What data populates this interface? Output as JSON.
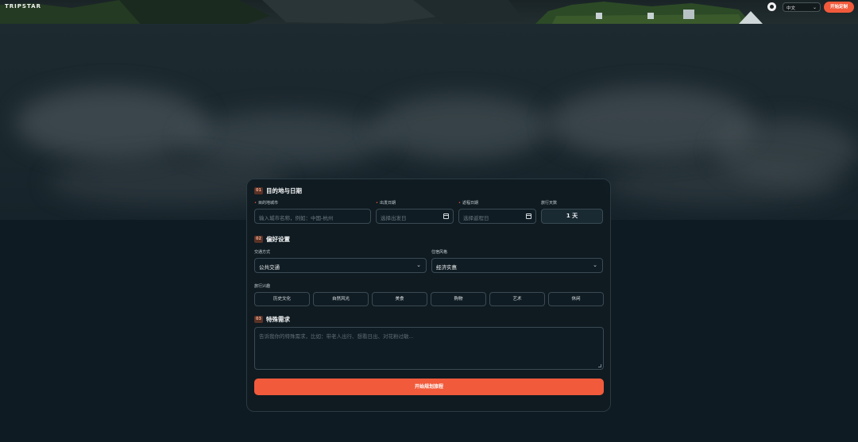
{
  "header": {
    "brand": "TRIPSTAR",
    "github_icon": "github-icon",
    "language": "中文",
    "start_button": "开始定制"
  },
  "sections": {
    "destination": {
      "num": "01",
      "title": "目的地与日期",
      "city_label": "目的地城市",
      "city_placeholder": "输入城市名称，例如：中国-杭州",
      "depart_label": "出发日期",
      "depart_placeholder": "选择出发日",
      "return_label": "返程日期",
      "return_placeholder": "选择返程日",
      "days_label": "旅行天数",
      "days_value": "1 天"
    },
    "preferences": {
      "num": "02",
      "title": "偏好设置",
      "transport_label": "交通方式",
      "transport_value": "公共交通",
      "lodging_label": "住宿风格",
      "lodging_value": "经济实惠",
      "interests_label": "旅行兴趣",
      "interests": [
        "历史文化",
        "自然风光",
        "美食",
        "购物",
        "艺术",
        "休闲"
      ]
    },
    "special": {
      "num": "03",
      "title": "特殊需求",
      "placeholder": "告诉我你的特殊需求，比如：带老人出行、想看日出、对花粉过敏..."
    }
  },
  "submit_label": "开始规划旅程",
  "colors": {
    "accent": "#f15a3b",
    "card_bg": "#101b21",
    "field_border": "#3a4a53"
  }
}
